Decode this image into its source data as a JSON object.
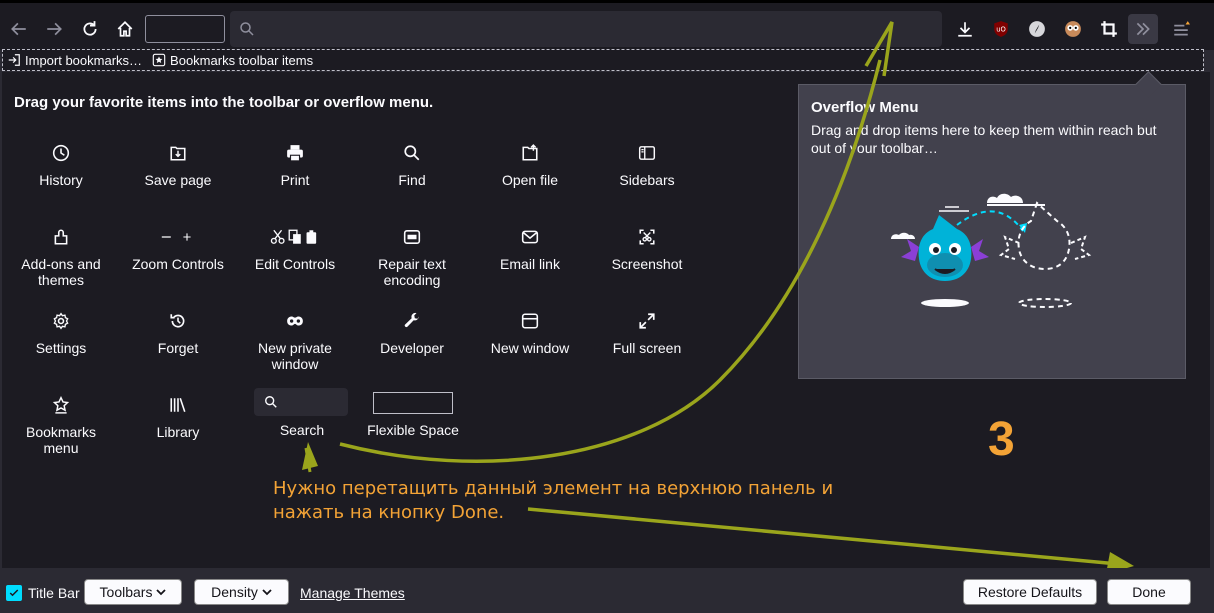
{
  "bookmarks_bar": {
    "import_label": "Import bookmarks…",
    "toolbar_items_label": "Bookmarks toolbar items"
  },
  "main": {
    "heading": "Drag your favorite items into the toolbar or overflow menu."
  },
  "palette": [
    {
      "label": "History",
      "icon": "history-icon"
    },
    {
      "label": "Save page",
      "icon": "save-page-icon"
    },
    {
      "label": "Print",
      "icon": "print-icon"
    },
    {
      "label": "Find",
      "icon": "find-icon"
    },
    {
      "label": "Open file",
      "icon": "open-file-icon"
    },
    {
      "label": "Sidebars",
      "icon": "sidebars-icon"
    },
    {
      "label": "Add-ons and themes",
      "icon": "addons-icon"
    },
    {
      "label": "Zoom Controls",
      "icon": "zoom-controls-icon"
    },
    {
      "label": "Edit Controls",
      "icon": "edit-controls-icon"
    },
    {
      "label": "Repair text encoding",
      "icon": "repair-encoding-icon"
    },
    {
      "label": "Email link",
      "icon": "email-link-icon"
    },
    {
      "label": "Screenshot",
      "icon": "screenshot-icon"
    },
    {
      "label": "Settings",
      "icon": "settings-icon"
    },
    {
      "label": "Forget",
      "icon": "forget-icon"
    },
    {
      "label": "New private window",
      "icon": "private-window-icon"
    },
    {
      "label": "Developer",
      "icon": "developer-icon"
    },
    {
      "label": "New window",
      "icon": "new-window-icon"
    },
    {
      "label": "Full screen",
      "icon": "full-screen-icon"
    },
    {
      "label": "Bookmarks menu",
      "icon": "bookmarks-menu-icon"
    },
    {
      "label": "Library",
      "icon": "library-icon"
    },
    {
      "label": "Search",
      "icon": "search-icon"
    },
    {
      "label": "Flexible Space",
      "icon": "flexible-space-icon"
    }
  ],
  "overflow": {
    "title": "Overflow Menu",
    "description": "Drag and drop items here to keep them within reach but out of your toolbar…"
  },
  "annotation": {
    "step_number": "3",
    "text": "Нужно перетащить данный элемент на верхнюю панель и нажать на кнопку Done.",
    "color": "#f3a336",
    "arrow_color": "#9aa51c"
  },
  "bottom": {
    "title_bar_label": "Title Bar",
    "title_bar_checked": true,
    "toolbars_label": "Toolbars",
    "density_label": "Density",
    "manage_themes_label": "Manage Themes",
    "restore_defaults_label": "Restore Defaults",
    "done_label": "Done"
  },
  "colors": {
    "background": "#1c1b22",
    "accent": "#00ddff"
  }
}
